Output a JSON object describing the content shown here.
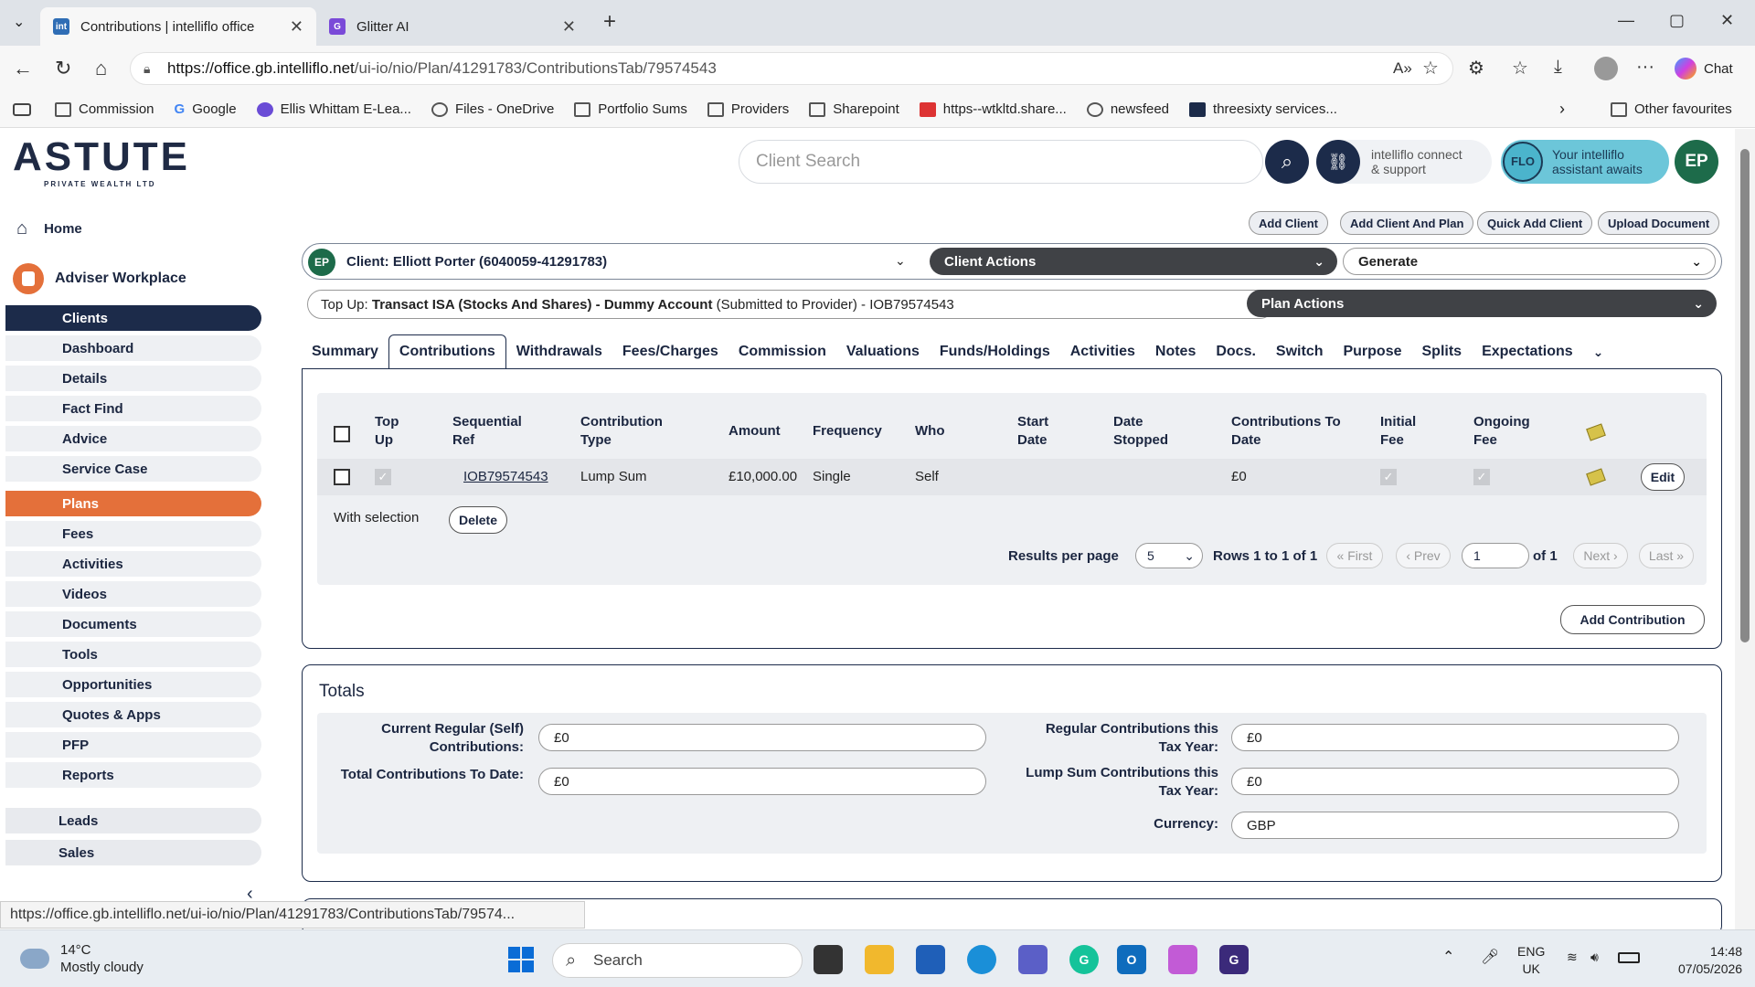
{
  "browser": {
    "tabs": [
      {
        "title": "Contributions | intelliflo office",
        "favicon": "int"
      },
      {
        "title": "Glitter AI",
        "favicon": "G"
      }
    ],
    "url_host": "https://office.gb.intelliflo.net",
    "url_path": "/ui-io/nio/Plan/41291783/ContributionsTab/79574543",
    "chat_label": "Chat",
    "bookmarks": [
      "Commission",
      "Google",
      "Ellis Whittam E-Lea...",
      "Files - OneDrive",
      "Portfolio Sums",
      "Providers",
      "Sharepoint",
      "https--wtkltd.share...",
      "newsfeed",
      "threesixty services..."
    ],
    "other_favourites": "Other favourites",
    "status_url": "https://office.gb.intelliflo.net/ui-io/nio/Plan/41291783/ContributionsTab/79574..."
  },
  "brand": {
    "logo": "ASTUTE",
    "tagline": "PRIVATE WEALTH LTD"
  },
  "header": {
    "search_placeholder": "Client Search",
    "connect_line1": "intelliflo connect",
    "connect_line2": "& support",
    "flo_badge": "FLO",
    "assistant_line1": "Your intelliflo",
    "assistant_line2": "assistant awaits",
    "user_initials": "EP"
  },
  "sidebar": {
    "home": "Home",
    "adviser": "Adviser Workplace",
    "items": [
      "Clients",
      "Dashboard",
      "Details",
      "Fact Find",
      "Advice",
      "Service Case",
      "Plans",
      "Fees",
      "Activities",
      "Videos",
      "Documents",
      "Tools",
      "Opportunities",
      "Quotes & Apps",
      "PFP",
      "Reports"
    ],
    "groups": [
      "Leads",
      "Sales"
    ]
  },
  "actions": {
    "add_client": "Add Client",
    "add_client_plan": "Add Client And Plan",
    "quick_add": "Quick Add Client",
    "upload": "Upload Document"
  },
  "client": {
    "initials": "EP",
    "label": "Client: Elliott Porter (6040059-41291783)",
    "client_actions": "Client Actions",
    "generate": "Generate"
  },
  "plan": {
    "prefix": "Top Up: ",
    "name": "Transact ISA (Stocks And Shares) - Dummy Account",
    "suffix": " (Submitted to Provider) - IOB79574543",
    "plan_actions": "Plan Actions"
  },
  "tabs": [
    "Summary",
    "Contributions",
    "Withdrawals",
    "Fees/Charges",
    "Commission",
    "Valuations",
    "Funds/Holdings",
    "Activities",
    "Notes",
    "Docs.",
    "Switch",
    "Purpose",
    "Splits",
    "Expectations"
  ],
  "table": {
    "headers": {
      "topup": [
        "Top",
        "Up"
      ],
      "seqref": [
        "Sequential",
        "Ref"
      ],
      "ctype": [
        "Contribution",
        "Type"
      ],
      "amount": "Amount",
      "frequency": "Frequency",
      "who": "Who",
      "start": [
        "Start",
        "Date"
      ],
      "stopped": [
        "Date",
        "Stopped"
      ],
      "todate": [
        "Contributions To",
        "Date"
      ],
      "initial": [
        "Initial",
        "Fee"
      ],
      "ongoing": [
        "Ongoing",
        "Fee"
      ]
    },
    "row": {
      "ref": "IOB79574543",
      "type": "Lump Sum",
      "amount": "£10,000.00",
      "frequency": "Single",
      "who": "Self",
      "todate": "£0",
      "edit": "Edit"
    },
    "with_selection": "With selection",
    "delete": "Delete",
    "results_per_page_label": "Results per page",
    "results_per_page": "5",
    "rows_info": "Rows 1 to 1 of 1",
    "first": "« First",
    "prev": "‹ Prev",
    "page": "1",
    "of_pages": "of 1",
    "next": "Next ›",
    "last": "Last »",
    "add_contribution": "Add Contribution"
  },
  "totals": {
    "title": "Totals",
    "current_regular_1": "Current Regular (Self)",
    "current_regular_2": "Contributions:",
    "current_regular_value": "£0",
    "total_to_date": "Total Contributions To Date:",
    "total_to_date_value": "£0",
    "regular_tax_1": "Regular Contributions this",
    "regular_tax_2": "Tax Year:",
    "regular_tax_value": "£0",
    "lump_tax_1": "Lump Sum Contributions this",
    "lump_tax_2": "Tax Year:",
    "lump_tax_value": "£0",
    "currency_label": "Currency:",
    "currency_value": "GBP"
  },
  "taskbar": {
    "temp": "14°C",
    "weather": "Mostly cloudy",
    "search": "Search",
    "lang1": "ENG",
    "lang2": "UK",
    "time": "14:48",
    "date": "07/05/2026"
  }
}
